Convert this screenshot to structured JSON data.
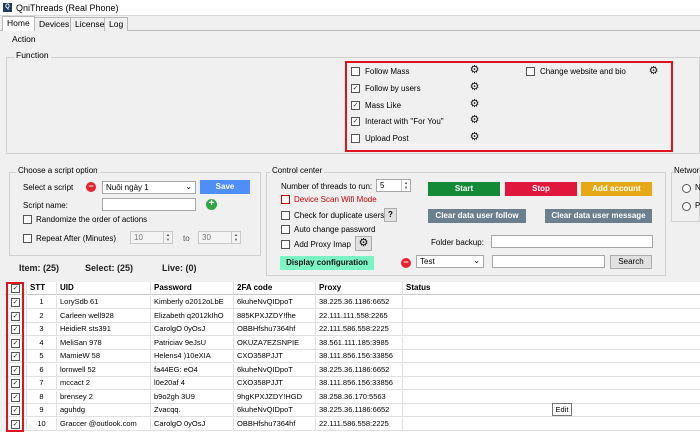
{
  "window": {
    "title": "QniThreads (Real Phone)",
    "icon_text": "Q"
  },
  "tabs": [
    "Home",
    "Devices",
    "License",
    "Log"
  ],
  "section_action": "Action",
  "section_function": "Function",
  "functions": [
    {
      "label": "Follow Mass",
      "checked": false
    },
    {
      "label": "Follow by users",
      "checked": true
    },
    {
      "label": "Mass Like",
      "checked": true
    },
    {
      "label": "Interact with \"For You\"",
      "checked": true
    },
    {
      "label": "Upload Post",
      "checked": false
    }
  ],
  "change_website": {
    "label": "Change website and bio",
    "checked": false
  },
  "script_panel": {
    "title": "Choose a script option",
    "select_label": "Select a script",
    "select_value": "Nuôi ngày 1",
    "save_label": "Save",
    "name_label": "Script name:",
    "name_value": "",
    "randomize_label": "Randomize the order of actions",
    "repeat_label": "Repeat After (Minutes)",
    "repeat_from": "10",
    "to_label": "to",
    "repeat_to": "30"
  },
  "control_panel": {
    "title": "Control center",
    "threads_label": "Number of threads to run:",
    "threads_value": "5",
    "scan_label": "Device Scan Wifi Mode",
    "duplicate_label": "Check for duplicate users",
    "duplicate_help": "?",
    "auto_pw_label": "Auto change password",
    "proxy_label": "Add Proxy Imap",
    "start": "Start",
    "stop": "Stop",
    "add_account": "Add account",
    "clear_follow": "Clear data user follow",
    "clear_message": "Clear data user message",
    "folder_label": "Folder backup:",
    "folder_value": "",
    "display_config": "Display configuration",
    "test_select": "Test",
    "search_value": "",
    "search_button": "Search"
  },
  "network_panel": {
    "title": "Network",
    "opt1": "N",
    "opt2": "P"
  },
  "stats": {
    "item": "Item: (25)",
    "selected": "Select: (25)",
    "live": "Live: (0)"
  },
  "table": {
    "headers": [
      "STT",
      "UID",
      "Password",
      "2FA code",
      "Proxy",
      "Status"
    ],
    "rows": [
      {
        "stt": "1",
        "uid": "LorySdb         61",
        "pw": "Kimberly      o2012oLbE",
        "fa": "6kuheNvQIDpoT",
        "proxy": "38.225.36.1186:6652"
      },
      {
        "stt": "2",
        "uid": "Carleen      well928",
        "pw": "Elizabeth      q2012kIhO",
        "fa": "885KPXJZDY!fhe",
        "proxy": "22.111.111.558:2265"
      },
      {
        "stt": "3",
        "uid": "HeidieR      sts391",
        "pw": "CarolgO      0yOsJ",
        "fa": "OBBHfshu7364hf",
        "proxy": "22.111.586.558:2225"
      },
      {
        "stt": "4",
        "uid": "MeliSan      978",
        "pw": "Patriciav      9eJsU",
        "fa": "OKUZA7EZSNPIE",
        "proxy": "38.561.111.185:3985"
      },
      {
        "stt": "5",
        "uid": "MamieW      58",
        "pw": "Helens4      )10eXIA",
        "fa": "CXO358PJJT",
        "proxy": "38.111.856.156:33856"
      },
      {
        "stt": "6",
        "uid": "lornwell      52",
        "pw": "fa44EG:      eO4",
        "fa": "6kuheNvQIDpoT",
        "proxy": "38.225.36.1186:6652"
      },
      {
        "stt": "7",
        "uid": "mccact      2",
        "pw": "l0e20af      4",
        "fa": "CXO358PJJT",
        "proxy": "38.111.856.156:33856"
      },
      {
        "stt": "8",
        "uid": "brensey      2",
        "pw": "b9o2gh      3U9",
        "fa": "9hgKPXJZDY!HGD",
        "proxy": "38.258.36.170:5563"
      },
      {
        "stt": "9",
        "uid": "aguhdg",
        "pw": "Zvacqq.",
        "fa": "6kuheNvQIDpoT",
        "proxy": "38.225.36.1186:6652"
      },
      {
        "stt": "10",
        "uid": "Graccer      @outlook.com",
        "pw": "CarolgO      0yOsJ",
        "fa": "OBBHfshu7364hf",
        "proxy": "22.111.586.558:2225"
      }
    ]
  },
  "tooltip": "Edit",
  "colors": {
    "start": "#138a36",
    "stop": "#e0163d",
    "add": "#e6a817",
    "clear": "#6b7f8e",
    "save": "#4f8ef7",
    "display": "#7cf5c5",
    "highlight": "#e0121d"
  }
}
